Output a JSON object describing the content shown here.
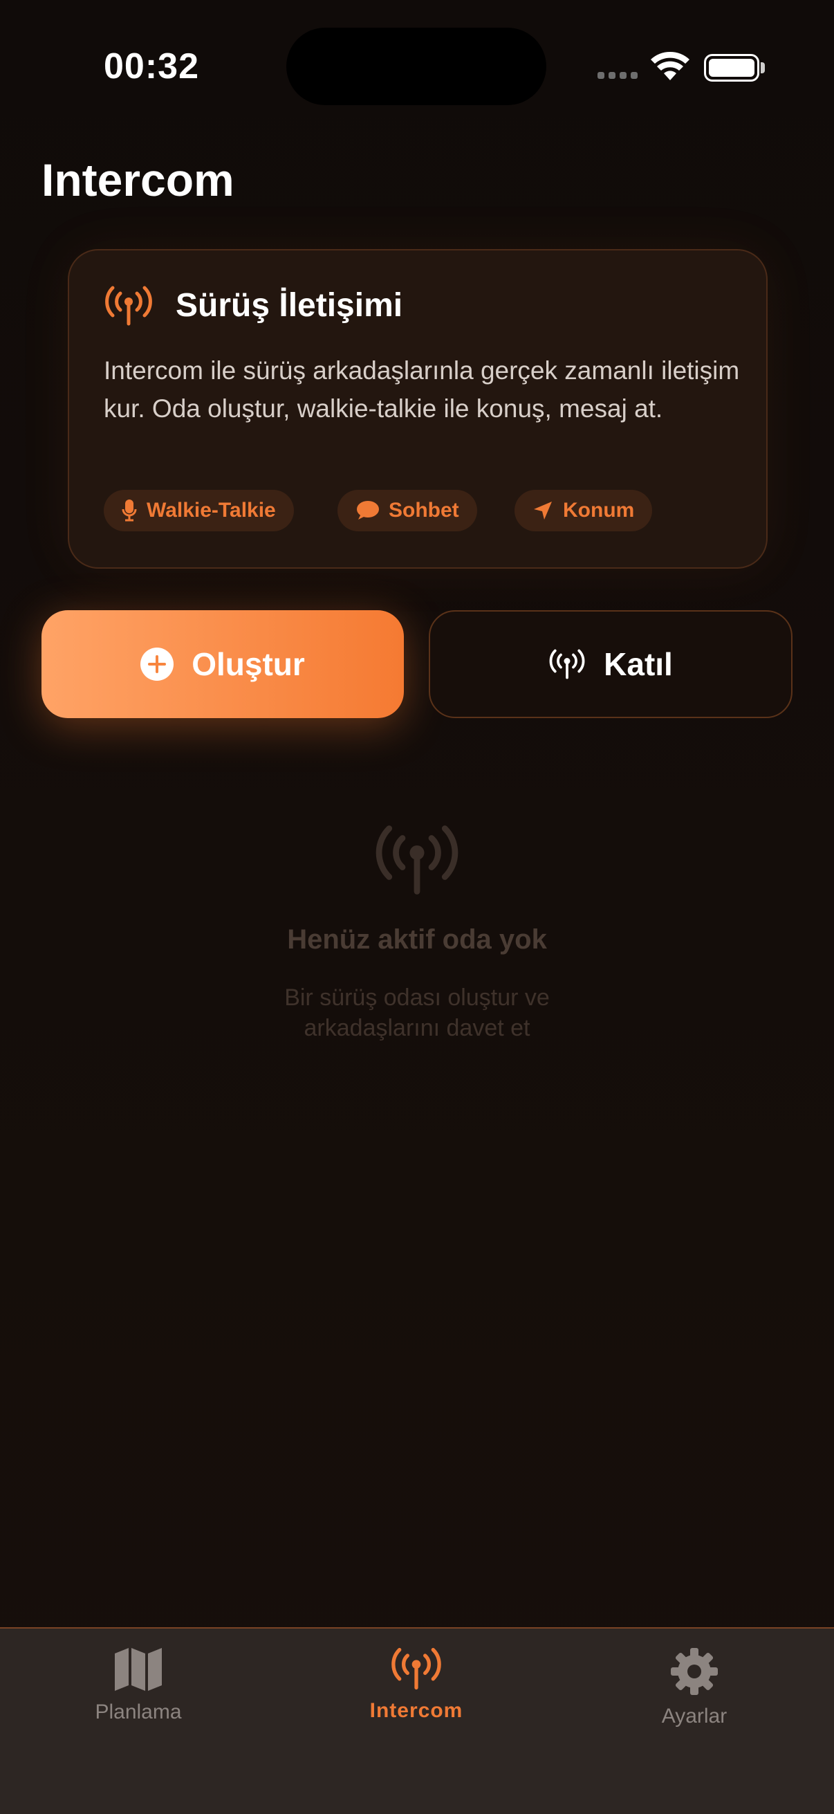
{
  "status_bar": {
    "time": "00:32"
  },
  "page": {
    "title": "Intercom"
  },
  "info_card": {
    "title": "Sürüş İletişimi",
    "description": "Intercom ile sürüş arkadaşlarınla gerçek zamanlı iletişim kur. Oda oluştur, walkie-talkie ile konuş, mesaj at.",
    "chips": [
      {
        "label": "Walkie-Talkie",
        "icon": "microphone-icon"
      },
      {
        "label": "Sohbet",
        "icon": "chat-bubble-icon"
      },
      {
        "label": "Konum",
        "icon": "location-arrow-icon"
      }
    ]
  },
  "actions": {
    "create_label": "Oluştur",
    "join_label": "Katıl"
  },
  "empty_state": {
    "title": "Henüz aktif oda yok",
    "subtitle_line1": "Bir sürüş odası oluştur ve",
    "subtitle_line2": "arkadaşlarını davet et"
  },
  "tab_bar": {
    "items": [
      {
        "label": "Planlama",
        "icon": "map-icon",
        "active": false
      },
      {
        "label": "Intercom",
        "icon": "antenna-icon",
        "active": true
      },
      {
        "label": "Ayarlar",
        "icon": "gear-icon",
        "active": false
      }
    ]
  },
  "colors": {
    "accent": "#f57a32",
    "accent_light": "#ffa366",
    "background": "#120c09",
    "card_background": "#23160f",
    "tab_bar_background": "#2d2623"
  }
}
